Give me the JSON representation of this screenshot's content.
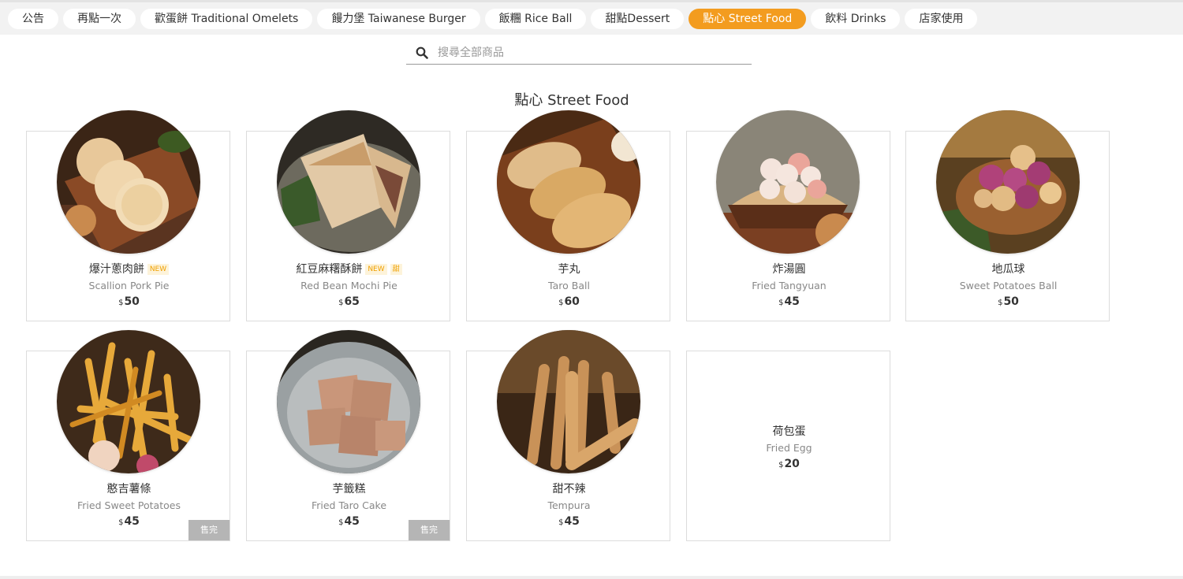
{
  "tabs": [
    {
      "label": "公告",
      "active": false
    },
    {
      "label": "再點一次",
      "active": false
    },
    {
      "label": "歡蛋餅 Traditional Omelets",
      "active": false
    },
    {
      "label": "饅力堡 Taiwanese Burger",
      "active": false
    },
    {
      "label": "飯糰 Rice Ball",
      "active": false
    },
    {
      "label": "甜點Dessert",
      "active": false
    },
    {
      "label": "點心 Street Food",
      "active": true
    },
    {
      "label": "飲料 Drinks",
      "active": false
    },
    {
      "label": "店家使用",
      "active": false
    }
  ],
  "search": {
    "placeholder": "搜尋全部商品",
    "value": ""
  },
  "section": {
    "title": "點心 Street Food"
  },
  "currency": "$",
  "items": [
    {
      "name": "爆汁蔥肉餅",
      "en": "Scallion Pork Pie",
      "price": "50",
      "badges": [
        "NEW"
      ],
      "sold_out": false,
      "has_image": true
    },
    {
      "name": "紅豆麻糬酥餅",
      "en": "Red Bean Mochi Pie",
      "price": "65",
      "badges": [
        "NEW",
        "甜"
      ],
      "sold_out": false,
      "has_image": true
    },
    {
      "name": "芋丸",
      "en": "Taro Ball",
      "price": "60",
      "badges": [],
      "sold_out": false,
      "has_image": true
    },
    {
      "name": "炸湯圓",
      "en": "Fried Tangyuan",
      "price": "45",
      "badges": [],
      "sold_out": false,
      "has_image": true
    },
    {
      "name": "地瓜球",
      "en": "Sweet Potatoes Ball",
      "price": "50",
      "badges": [],
      "sold_out": false,
      "has_image": true
    },
    {
      "name": "憨吉薯條",
      "en": "Fried Sweet Potatoes",
      "price": "45",
      "badges": [],
      "sold_out": true,
      "has_image": true
    },
    {
      "name": "芋籤糕",
      "en": "Fried Taro Cake",
      "price": "45",
      "badges": [],
      "sold_out": true,
      "has_image": true
    },
    {
      "name": "甜不辣",
      "en": "Tempura",
      "price": "45",
      "badges": [],
      "sold_out": false,
      "has_image": true
    },
    {
      "name": "荷包蛋",
      "en": "Fried Egg",
      "price": "20",
      "badges": [],
      "sold_out": false,
      "has_image": false
    }
  ],
  "sold_out_label": "售完",
  "colors": {
    "accent": "#f39c1f",
    "badge_text": "#f0a000",
    "soldout_bg": "#b5b5b5"
  },
  "icons": {
    "search": "search-icon"
  }
}
